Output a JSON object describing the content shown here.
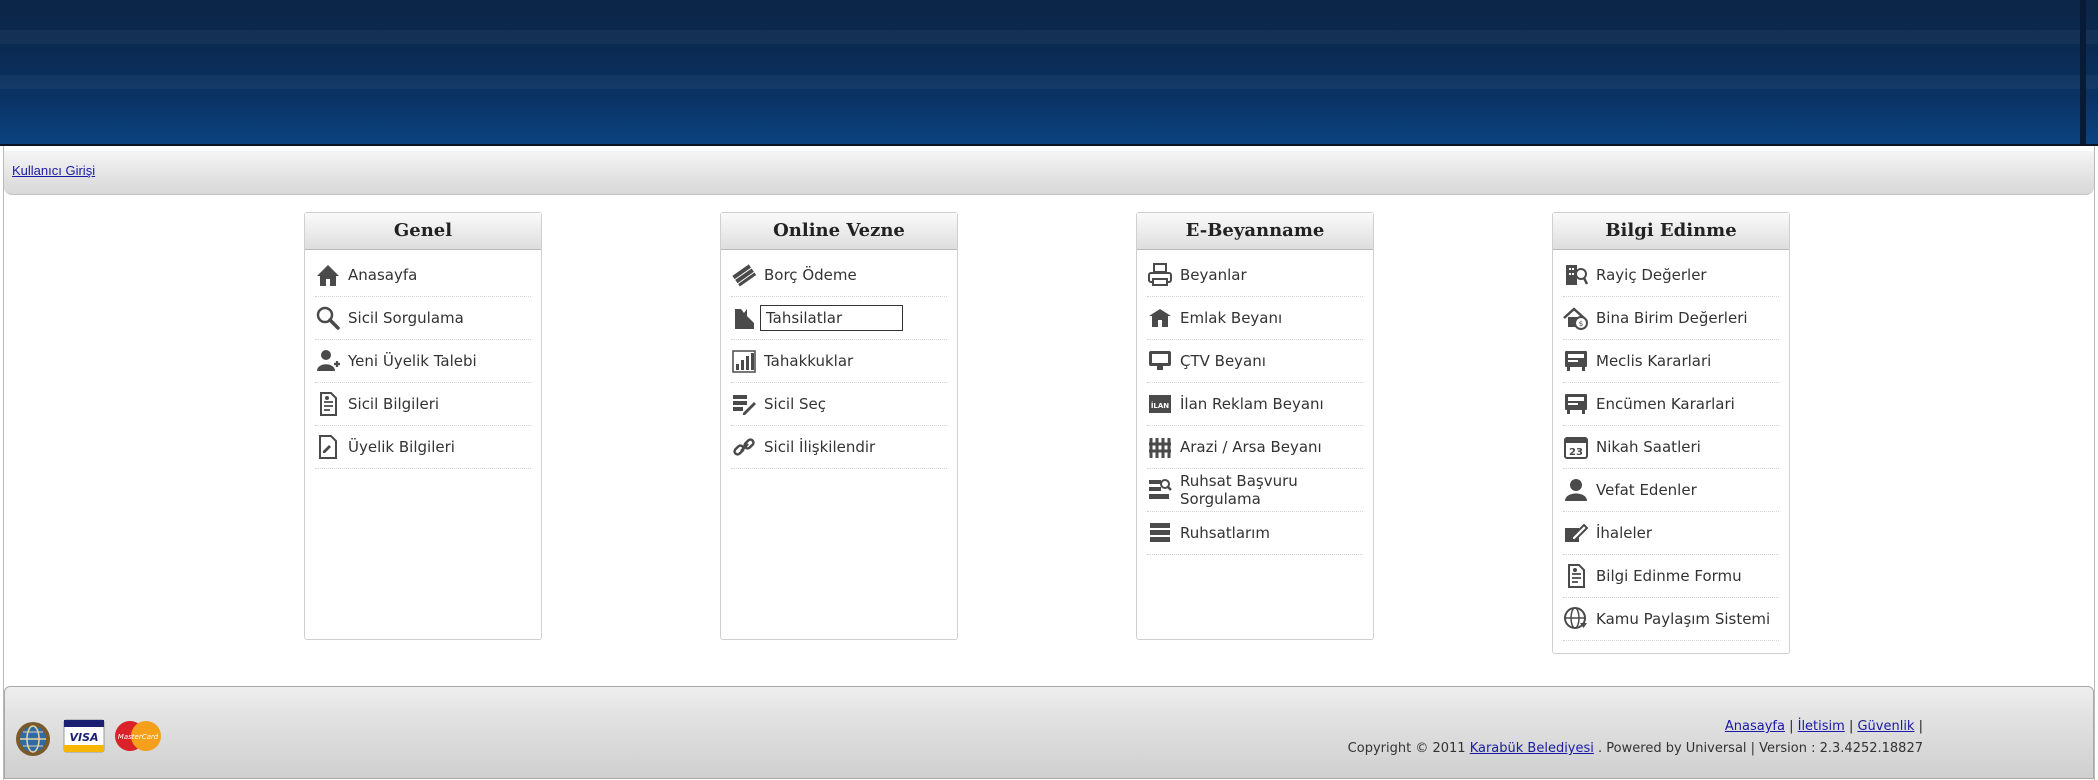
{
  "header": {
    "login_link": "Kullanıcı Girişi"
  },
  "panels": [
    {
      "title": "Genel",
      "items": [
        {
          "label": "Anasayfa",
          "icon": "home-icon"
        },
        {
          "label": "Sicil Sorgulama",
          "icon": "magnifier-icon"
        },
        {
          "label": "Yeni Üyelik Talebi",
          "icon": "add-user-icon"
        },
        {
          "label": "Sicil Bilgileri",
          "icon": "document-icon"
        },
        {
          "label": "Üyelik Bilgileri",
          "icon": "page-pen-icon"
        }
      ]
    },
    {
      "title": "Online Vezne",
      "items": [
        {
          "label": "Borç Ödeme",
          "icon": "money-icon"
        },
        {
          "label": "Tahsilatlar",
          "icon": "receipt-icon"
        },
        {
          "label": "Tahakkuklar",
          "icon": "bar-chart-icon"
        },
        {
          "label": "Sicil Seç",
          "icon": "pencil-list-icon"
        },
        {
          "label": "Sicil İlişkilendir",
          "icon": "link-icon"
        }
      ]
    },
    {
      "title": "E-Beyanname",
      "items": [
        {
          "label": "Beyanlar",
          "icon": "printer-icon"
        },
        {
          "label": "Emlak Beyanı",
          "icon": "house-icon"
        },
        {
          "label": "ÇTV Beyanı",
          "icon": "monitor-icon"
        },
        {
          "label": "İlan Reklam Beyanı",
          "icon": "ilan-icon",
          "icon_text": "İLAN"
        },
        {
          "label": "Arazi / Arsa Beyanı",
          "icon": "fence-icon"
        },
        {
          "label": "Ruhsat Başvuru Sorgulama",
          "icon": "search-list-icon"
        },
        {
          "label": "Ruhsatlarım",
          "icon": "stack-icon"
        }
      ]
    },
    {
      "title": "Bilgi Edinme",
      "items": [
        {
          "label": "Rayiç Değerler",
          "icon": "building-search-icon"
        },
        {
          "label": "Bina Birim Değerleri",
          "icon": "house-coin-icon"
        },
        {
          "label": "Meclis Kararlari",
          "icon": "council-icon"
        },
        {
          "label": "Encümen Kararlari",
          "icon": "council-icon"
        },
        {
          "label": "Nikah Saatleri",
          "icon": "calendar-icon",
          "icon_text": "23"
        },
        {
          "label": "Vefat Edenler",
          "icon": "person-icon"
        },
        {
          "label": "İhaleler",
          "icon": "edit-icon"
        },
        {
          "label": "Bilgi Edinme Formu",
          "icon": "form-icon"
        },
        {
          "label": "Kamu Paylaşım Sistemi",
          "icon": "globe-icon"
        }
      ]
    }
  ],
  "footer": {
    "links": [
      "Anasayfa",
      "İletisim",
      "Güvenlik"
    ],
    "copyright_prefix": "Copyright ©  2011",
    "copyright_link": "Karabük Belediyesi",
    "powered": ". Powered by Universal  | Version : 2.3.4252.18827",
    "card_labels": [
      "VISA",
      "MasterCard"
    ]
  },
  "colors": {
    "banner": "#0b3466",
    "link": "#1a1aa6",
    "panel_header": "#dedede"
  }
}
